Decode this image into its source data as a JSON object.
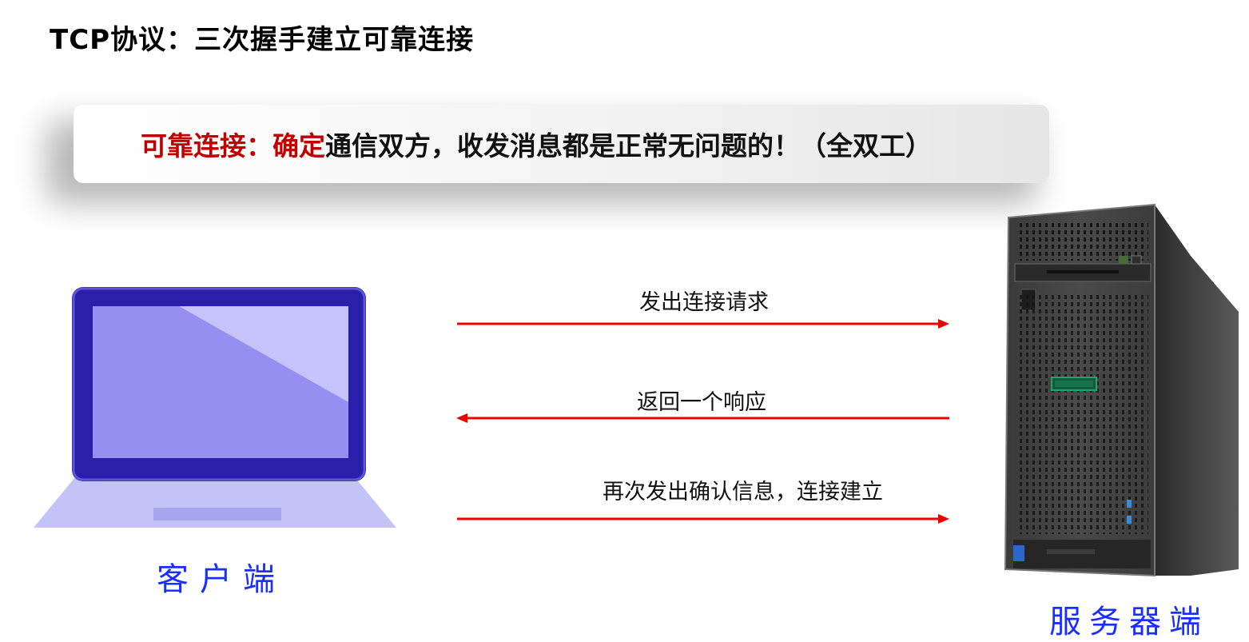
{
  "title": "TCP协议：三次握手建立可靠连接",
  "banner": {
    "red_text": "可靠连接：确定",
    "text": "通信双方，收发消息都是正常无问题的！（全双工）"
  },
  "messages": [
    {
      "label": "发出连接请求",
      "direction": "client-to-server"
    },
    {
      "label": "返回一个响应",
      "direction": "server-to-client"
    },
    {
      "label": "再次发出确认信息，连接建立",
      "direction": "client-to-server"
    }
  ],
  "client_label": "客户端",
  "server_label": "服务器端",
  "colors": {
    "arrow": "#ee0000",
    "highlight": "#c00000",
    "endpoint_label": "#1a2fff",
    "laptop": "#2a1faa"
  }
}
